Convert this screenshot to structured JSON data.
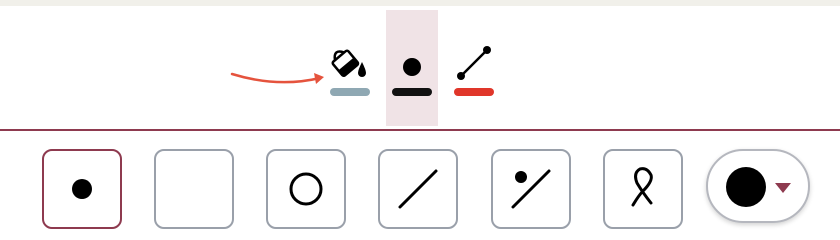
{
  "toolbar": {
    "style_buttons": [
      {
        "name": "fill",
        "icon": "paint-bucket-icon",
        "swatch_color": "#8fa8b3"
      },
      {
        "name": "point",
        "icon": "point-icon",
        "swatch_color": "#111111",
        "active": true
      },
      {
        "name": "line",
        "icon": "line-segment-icon",
        "swatch_color": "#e0362a"
      }
    ],
    "active_bg": "#f0e3e6",
    "hint_arrow_color": "#e5533d"
  },
  "tools": [
    {
      "name": "point",
      "icon": "point-tool-icon",
      "selected": true
    },
    {
      "name": "empty",
      "icon": "empty-tool-icon",
      "selected": false
    },
    {
      "name": "circle",
      "icon": "circle-tool-icon",
      "selected": false
    },
    {
      "name": "line",
      "icon": "line-tool-icon",
      "selected": false
    },
    {
      "name": "point-on-line",
      "icon": "point-line-tool-icon",
      "selected": false
    },
    {
      "name": "lasso",
      "icon": "lasso-tool-icon",
      "selected": false
    }
  ],
  "color_picker": {
    "current_color": "#000000",
    "caret_color": "#8e3a4f",
    "icon": "chevron-down-icon"
  },
  "colors": {
    "accent": "#8e3a4f",
    "border": "#9aa0aa",
    "top_strip": "#f1f0ea"
  }
}
